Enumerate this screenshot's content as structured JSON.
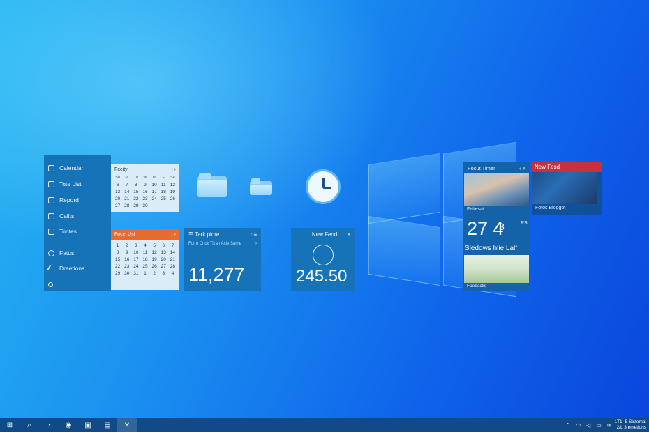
{
  "sidebar": {
    "items": [
      {
        "label": "Calendar",
        "icon": "calendar-icon"
      },
      {
        "label": "Tote List",
        "icon": "list-icon"
      },
      {
        "label": "Repord",
        "icon": "report-icon"
      },
      {
        "label": "Callts",
        "icon": "calls-icon"
      },
      {
        "label": "Tontes",
        "icon": "notes-icon"
      },
      {
        "label": "Fatus",
        "icon": "settings-icon"
      },
      {
        "label": "Dreetions",
        "icon": "directions-icon"
      },
      {
        "label": "",
        "icon": "circle-icon"
      }
    ]
  },
  "calendar_top": {
    "title": "Fecity",
    "days": [
      "Su",
      "M",
      "Tu",
      "W",
      "Th",
      "F",
      "Sa"
    ],
    "dates": [
      "6",
      "7",
      "8",
      "9",
      "10",
      "11",
      "12",
      "13",
      "14",
      "15",
      "16",
      "17",
      "18",
      "19",
      "20",
      "21",
      "22",
      "23",
      "24",
      "25",
      "26",
      "27",
      "28",
      "29",
      "30"
    ]
  },
  "focus_list": {
    "title": "Focei Ust",
    "dates": [
      "1",
      "2",
      "3",
      "4",
      "5",
      "6",
      "7",
      "8",
      "9",
      "10",
      "11",
      "12",
      "13",
      "14",
      "15",
      "16",
      "17",
      "18",
      "19",
      "20",
      "21",
      "22",
      "23",
      "24",
      "25",
      "26",
      "27",
      "28",
      "29",
      "30",
      "31",
      "1",
      "2",
      "3",
      "4"
    ]
  },
  "task_tile": {
    "title": "Tark plore",
    "subtitle": "Form Crick Tizan Acle Sarne",
    "value": "11,277"
  },
  "news_tile": {
    "title": "New Feod",
    "value": "245.50"
  },
  "focus_timer": {
    "title": "Focut Timer",
    "photo_caption": "Fatiesat",
    "value": "27 4",
    "small": "3",
    "small2": "RS",
    "subtitle": "Sledows hlie Lalf",
    "caption2": "Foobaclio"
  },
  "new_feed": {
    "title": "New Fesd",
    "caption": "Fotos Bloggot"
  },
  "taskbar": {
    "buttons": [
      "start-icon",
      "search-icon",
      "edge-icon",
      "chrome-icon",
      "store-icon",
      "news-icon",
      "app-icon"
    ],
    "time": "1T1 -5 Sistemal",
    "date": "2/L 3 emetions"
  },
  "colors": {
    "accent": "#1673b8",
    "focus_orange": "#e86a2c",
    "feed_red": "#c8303b"
  }
}
